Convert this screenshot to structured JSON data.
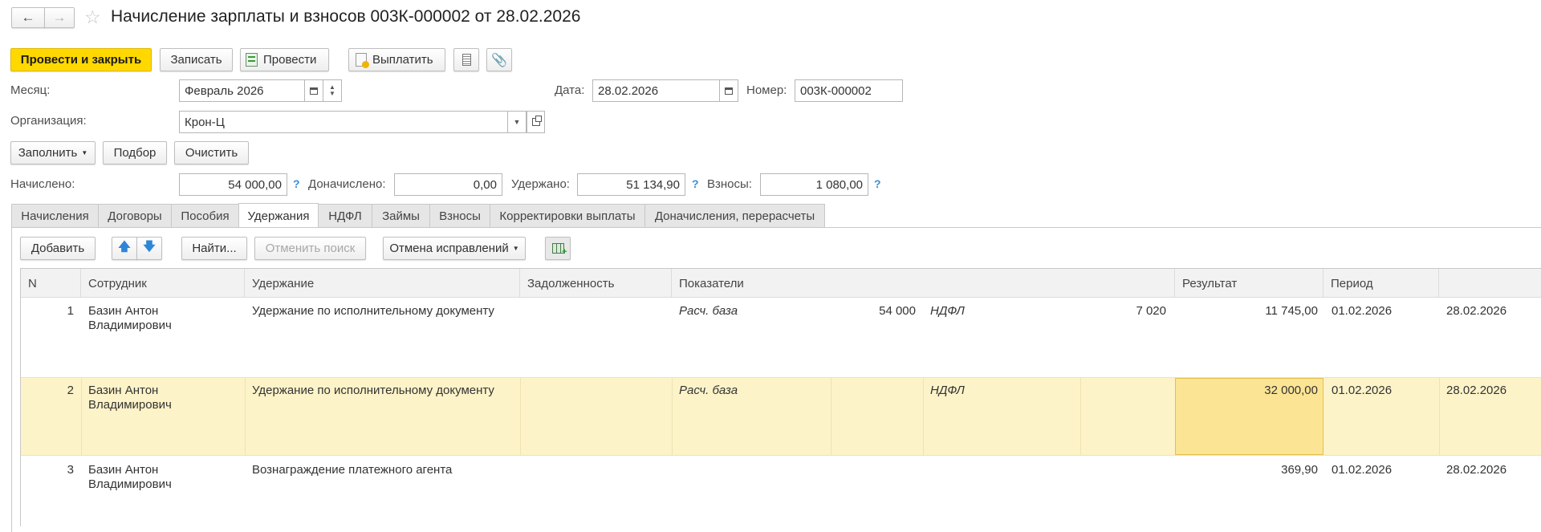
{
  "window": {
    "title": "Начисление зарплаты и взносов 003К-000002 от 28.02.2026",
    "back_icon": "arrow-left-icon",
    "forward_icon": "arrow-right-icon",
    "star_icon": "star-icon"
  },
  "toolbar": {
    "post_close": "Провести и закрыть",
    "save": "Записать",
    "post": "Провести",
    "pay": "Выплатить"
  },
  "header": {
    "month_label": "Месяц:",
    "month_value": "Февраль 2026",
    "date_label": "Дата:",
    "date_value": "28.02.2026",
    "number_label": "Номер:",
    "number_value": "003К-000002",
    "org_label": "Организация:",
    "org_value": "Крон-Ц"
  },
  "actions": {
    "fill": "Заполнить",
    "select": "Подбор",
    "clear": "Очистить"
  },
  "totals": {
    "accrued_label": "Начислено:",
    "accrued_value": "54 000,00",
    "extra_label": "Доначислено:",
    "extra_value": "0,00",
    "withheld_label": "Удержано:",
    "withheld_value": "51 134,90",
    "contrib_label": "Взносы:",
    "contrib_value": "1 080,00",
    "help": "?"
  },
  "tabs": [
    {
      "label": "Начисления"
    },
    {
      "label": "Договоры"
    },
    {
      "label": "Пособия"
    },
    {
      "label": "Удержания"
    },
    {
      "label": "НДФЛ"
    },
    {
      "label": "Займы"
    },
    {
      "label": "Взносы"
    },
    {
      "label": "Корректировки выплаты"
    },
    {
      "label": "Доначисления, перерасчеты"
    }
  ],
  "active_tab": "Удержания",
  "table_toolbar": {
    "add": "Добавить",
    "find": "Найти...",
    "cancel_search": "Отменить поиск",
    "cancel_fix": "Отмена исправлений"
  },
  "table": {
    "columns": [
      "N",
      "Сотрудник",
      "Удержание",
      "Задолженность",
      "Показатели",
      "Результат",
      "Период"
    ],
    "rows": [
      {
        "n": "1",
        "employee_line1": "Базин Антон",
        "employee_line2": "Владимирович",
        "deduction": "Удержание по исполнительному документу",
        "debt": "",
        "ind1_name": "Расч. база",
        "ind1_value": "54 000",
        "ind2_name": "НДФЛ",
        "ind2_value": "7 020",
        "result": "11 745,00",
        "period_start": "01.02.2026",
        "period_end": "28.02.2026"
      },
      {
        "n": "2",
        "employee_line1": "Базин Антон",
        "employee_line2": "Владимирович",
        "deduction": "Удержание по исполнительному документу",
        "debt": "",
        "ind1_name": "Расч. база",
        "ind1_value": "",
        "ind2_name": "НДФЛ",
        "ind2_value": "",
        "result": "32 000,00",
        "period_start": "01.02.2026",
        "period_end": "28.02.2026"
      },
      {
        "n": "3",
        "employee_line1": "Базин Антон",
        "employee_line2": "Владимирович",
        "deduction": "Вознаграждение платежного агента",
        "debt": "",
        "ind1_name": "",
        "ind1_value": "",
        "ind2_name": "",
        "ind2_value": "",
        "result": "369,90",
        "period_start": "01.02.2026",
        "period_end": "28.02.2026"
      }
    ]
  },
  "colors": {
    "primary": "#ffd800",
    "selected_row": "#fdf3c8",
    "selected_cell": "#fbe594",
    "help": "#3a8ed6"
  }
}
